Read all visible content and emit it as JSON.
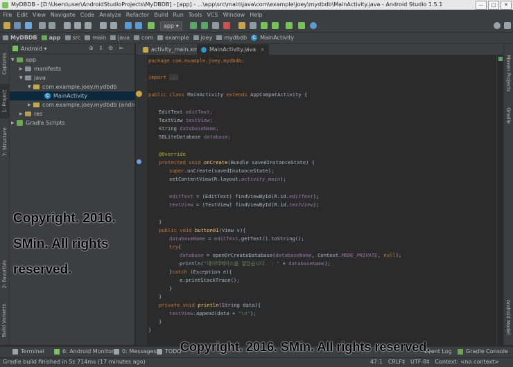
{
  "window": {
    "title": "MyDBDB - [D:\\Users\\user\\AndroidStudioProjects\\MyDBDB] - [app] - ...\\app\\src\\main\\java\\com\\example\\joey\\mydbdb\\MainActivity.java - Android Studio 1.5.1",
    "min": "—",
    "max": "□",
    "close": "✕"
  },
  "menu": [
    "File",
    "Edit",
    "View",
    "Navigate",
    "Code",
    "Analyze",
    "Refactor",
    "Build",
    "Run",
    "Tools",
    "VCS",
    "Window",
    "Help"
  ],
  "toolbar": {
    "run_config": "app ▾"
  },
  "breadcrumbs": [
    "MyDBDB",
    "app",
    "src",
    "main",
    "java",
    "com",
    "example",
    "joey",
    "mydbdb",
    "MainActivity"
  ],
  "left_tabs": [
    "Captures",
    "1: Project",
    "7: Structure",
    "2: Favorites",
    "Build Variants"
  ],
  "right_tabs": [
    "Maven Projects",
    "Gradle",
    "Android Model"
  ],
  "project": {
    "view": "Android ▾",
    "tree": [
      "app",
      "manifests",
      "java",
      "com.example.joey.mydbdb",
      "MainActivity",
      "com.example.joey.mydbdb (android",
      "res",
      "Gradle Scripts"
    ]
  },
  "editor_tabs": [
    {
      "label": "activity_main.xml",
      "close": "×"
    },
    {
      "label": "MainActivity.java",
      "close": "×"
    }
  ],
  "code": {
    "l1": "package com.example.joey.mydbdb;",
    "l2a": "import ",
    "l2b": "...",
    "l3a": "public class ",
    "l3b": "MainActivity ",
    "l3c": "extends ",
    "l3d": "AppCompatActivity {",
    "f1a": "EditText ",
    "f1b": "editText",
    "f1c": ";",
    "f2a": "TextView ",
    "f2b": "textView",
    "f2c": ";",
    "f3a": "String ",
    "f3b": "databaseName",
    "f3c": ";",
    "f4a": "SQLiteDatabase ",
    "f4b": "database",
    "f4c": ";",
    "ann": "@Override",
    "oc1a": "protected void ",
    "oc1b": "onCreate",
    "oc1c": "(Bundle savedInstanceState) {",
    "oc2a": "super",
    "oc2b": ".onCreate(savedInstanceState);",
    "oc3a": "setContentView(R.layout.",
    "oc3b": "activity_main",
    "oc3c": ");",
    "oc4a": "editText ",
    "oc4b": "= (EditText) findViewById(R.id.",
    "oc4c": "editText",
    "oc4d": ");",
    "oc5a": "textView ",
    "oc5b": "= (TextView) findViewById(R.id.",
    "oc5c": "textView",
    "oc5d": ");",
    "close1": "}",
    "b1a": "public void ",
    "b1b": "button01",
    "b1c": "(View v){",
    "b2a": "databaseName ",
    "b2b": "= ",
    "b2c": "editText",
    "b2d": ".getText().toString();",
    "b3a": "try",
    "b3b": "{",
    "b4a": "database ",
    "b4b": "= openOrCreateDatabase(",
    "b4c": "databaseName",
    "b4d": ", Context.",
    "b4e": "MODE_PRIVATE",
    "b4f": ", ",
    "b4g": "null",
    "b4h": ");",
    "b5a": "println(",
    "b5b": "\"데이터베이스를 열었습니다. : \"",
    "b5c": " + ",
    "b5d": "databaseName",
    "b5e": ");",
    "b6a": "}",
    "b6b": "catch ",
    "b6c": "(Exception e){",
    "b7": "e.printStackTrace();",
    "b8": "}",
    "b9": "}",
    "p1a": "private void ",
    "p1b": "println",
    "p1c": "(String data){",
    "p2a": "textView",
    "p2b": ".append(data + ",
    "p2c": "\"\\n\"",
    "p2d": ");",
    "p3": "}",
    "p4": "}"
  },
  "bottom_tabs": [
    "Terminal",
    "6: Android Monitor",
    "0: Messages",
    "TODO",
    "Event Log",
    "Gradle Console"
  ],
  "status": {
    "message": "Gradle build finished in 5s 714ms (17 minutes ago)",
    "position": "47:1",
    "line_sep": "CRLF‡",
    "encoding": "UTF-8‡",
    "context": "Context: <no context>"
  },
  "watermark": {
    "left": "Copyright. 2016. SMin. All rights reserved.",
    "bottom": "Copyright. 2016. SMin. All rights reserved."
  },
  "colors": {
    "bg": "#2b2b2b",
    "panel": "#3c3f41",
    "keyword": "#cc7832",
    "field": "#9876aa",
    "string": "#6a8759",
    "annotation": "#bbb529"
  }
}
